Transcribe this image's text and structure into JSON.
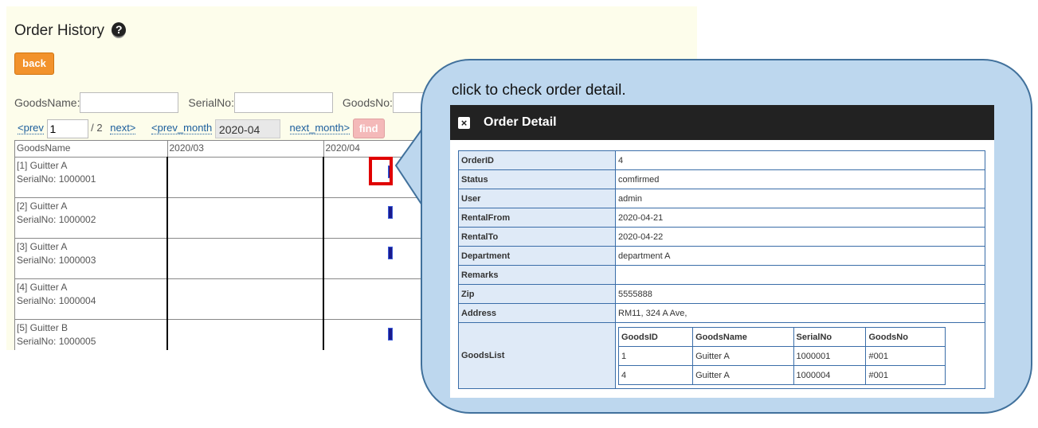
{
  "page": {
    "title": "Order History",
    "help_icon": "?",
    "back_label": "back"
  },
  "filters": [
    {
      "label": "GoodsName:",
      "value": ""
    },
    {
      "label": "SerialNo:",
      "value": ""
    },
    {
      "label": "GoodsNo:",
      "value": ""
    }
  ],
  "pager": {
    "prev": "<prev",
    "page": "1",
    "total": "/ 2",
    "next": "next>",
    "prev_month": "<prev_month",
    "month": "2020-04",
    "next_month": "next_month>",
    "find": "find"
  },
  "grid": {
    "headers": [
      "GoodsName",
      "2020/03",
      "2020/04"
    ],
    "rows": [
      {
        "name": "[1] Guitter A",
        "serial": "SerialNo: 1000001",
        "has_order": true
      },
      {
        "name": "[2] Guitter A",
        "serial": "SerialNo: 1000002",
        "has_order": true
      },
      {
        "name": "[3] Guitter A",
        "serial": "SerialNo: 1000003",
        "has_order": true
      },
      {
        "name": "[4] Guitter A",
        "serial": "SerialNo: 1000004",
        "has_order": false
      },
      {
        "name": "[5] Guitter B",
        "serial": "SerialNo: 1000005",
        "has_order": true
      }
    ]
  },
  "callout": {
    "text": "click to check order detail."
  },
  "dialog": {
    "close_icon": "×",
    "title": "Order Detail",
    "fields": [
      {
        "key": "OrderID",
        "value": "4"
      },
      {
        "key": "Status",
        "value": "comfirmed"
      },
      {
        "key": "User",
        "value": "admin"
      },
      {
        "key": "RentalFrom",
        "value": "2020-04-21"
      },
      {
        "key": "RentalTo",
        "value": "2020-04-22"
      },
      {
        "key": "Department",
        "value": "department A"
      },
      {
        "key": "Remarks",
        "value": ""
      },
      {
        "key": "Zip",
        "value": "5555888"
      },
      {
        "key": "Address",
        "value": "RM11, 324 A Ave,"
      }
    ],
    "goods_label": "GoodsList",
    "goods_headers": [
      "GoodsID",
      "GoodsName",
      "SerialNo",
      "GoodsNo"
    ],
    "goods_rows": [
      [
        "1",
        "Guitter A",
        "1000001",
        "#001"
      ],
      [
        "4",
        "Guitter A",
        "1000004",
        "#001"
      ]
    ]
  },
  "colors": {
    "panel_bg": "#fdfdeb",
    "back_button": "#f2922c",
    "find_button": "#f4b9b9",
    "order_bar": "#1a1a8c",
    "callout_fill": "#bdd7ee",
    "callout_border": "#41719c",
    "highlight": "#e00000"
  }
}
